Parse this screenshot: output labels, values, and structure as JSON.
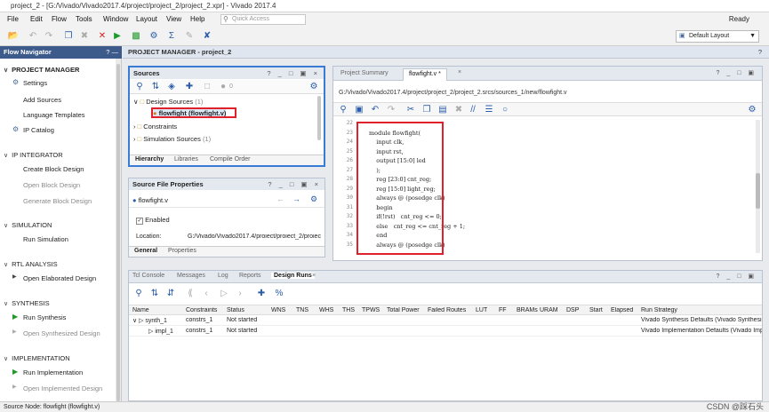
{
  "window": {
    "title": "project_2 - [G:/Vivado/Vivado2017.4/project/project_2/project_2.xpr] - Vivado 2017.4",
    "status": "Ready"
  },
  "menu": [
    "File",
    "Edit",
    "Flow",
    "Tools",
    "Window",
    "Layout",
    "View",
    "Help"
  ],
  "quick_access": {
    "placeholder": "Quick Access"
  },
  "layout_select": {
    "value": "Default Layout"
  },
  "flow_navigator": {
    "title": "Flow Navigator",
    "controls": "? —",
    "sections": [
      {
        "label": "PROJECT MANAGER",
        "items": [
          "Settings",
          "Add Sources",
          "Language Templates",
          "IP Catalog"
        ]
      },
      {
        "label": "IP INTEGRATOR",
        "items": [
          "Create Block Design",
          "Open Block Design",
          "Generate Block Design"
        ]
      },
      {
        "label": "SIMULATION",
        "items": [
          "Run Simulation"
        ]
      },
      {
        "label": "RTL ANALYSIS",
        "items": [
          "Open Elaborated Design"
        ]
      },
      {
        "label": "SYNTHESIS",
        "items": [
          "Run Synthesis",
          "Open Synthesized Design"
        ]
      },
      {
        "label": "IMPLEMENTATION",
        "items": [
          "Run Implementation",
          "Open Implemented Design"
        ]
      }
    ]
  },
  "project_manager": {
    "title": "PROJECT MANAGER - project_2",
    "help": "?"
  },
  "sources": {
    "title": "Sources",
    "controls": "? _ □ ▣ ×",
    "badge": "0",
    "tree": [
      {
        "label": "Design Sources",
        "count": "(1)"
      },
      {
        "label": "flowfight (flowfight.v)"
      },
      {
        "label": "Constraints"
      },
      {
        "label": "Simulation Sources",
        "count": "(1)"
      }
    ],
    "tabs": [
      "Hierarchy",
      "Libraries",
      "Compile Order"
    ]
  },
  "source_file_properties": {
    "title": "Source File Properties",
    "controls": "? _ □ ▣ ×",
    "file": "flowfight.v",
    "enabled_label": "Enabled",
    "location_label": "Location:",
    "location_value": "G:/Vivado/Vivado2017.4/proiect/proiect_2/proiect",
    "tabs": [
      "General",
      "Properties"
    ]
  },
  "editor": {
    "tabs": [
      "Project Summary",
      "flowfight.v *"
    ],
    "controls": "? _ □ ▣",
    "path": "G:/Vivado/Vivado2017.4/project/project_2/project_2.srcs/sources_1/new/flowfight.v",
    "lines": [
      {
        "n": "22",
        "code": ""
      },
      {
        "n": "23",
        "code": "module flowfight("
      },
      {
        "n": "24",
        "code": "    input clk,"
      },
      {
        "n": "25",
        "code": "    input rst,"
      },
      {
        "n": "26",
        "code": "    output [15:0] led"
      },
      {
        "n": "27",
        "code": "    );"
      },
      {
        "n": "28",
        "code": "    reg [23:0] cnt_reg;"
      },
      {
        "n": "29",
        "code": "    reg [15:0] light_reg;"
      },
      {
        "n": "30",
        "code": "    always @ (posedge clk)"
      },
      {
        "n": "31",
        "code": "    begin"
      },
      {
        "n": "32",
        "code": "    if(!rst)   cnt_reg <= 0;"
      },
      {
        "n": "33",
        "code": "    else   cnt_reg <= cnt_reg + 1;"
      },
      {
        "n": "34",
        "code": "    end"
      },
      {
        "n": "35",
        "code": "    always @ (posedge clk)"
      }
    ]
  },
  "bottom_panel": {
    "tabs": [
      "Tcl Console",
      "Messages",
      "Log",
      "Reports",
      "Design Runs"
    ],
    "controls": "? _ □ ▣",
    "columns": [
      "Name",
      "Constraints",
      "Status",
      "WNS",
      "TNS",
      "WHS",
      "THS",
      "TPWS",
      "Total Power",
      "Failed Routes",
      "LUT",
      "FF",
      "BRAMs",
      "URAM",
      "DSP",
      "Start",
      "Elapsed",
      "Run Strategy"
    ],
    "rows": [
      {
        "name": "synth_1",
        "constraints": "constrs_1",
        "status": "Not started",
        "strategy": "Vivado Synthesis Defaults (Vivado Synthesis"
      },
      {
        "name": "impl_1",
        "constraints": "constrs_1",
        "status": "Not started",
        "strategy": "Vivado Implementation Defaults (Vivado Imp"
      }
    ]
  },
  "statusbar": {
    "text": "Source Node: flowfight (flowfight.v)",
    "watermark": "CSDN @踩石头"
  },
  "colors": {
    "accent": "#3c5a8a",
    "highlight_box": "#e0202a",
    "selection": "#3a7bd5"
  }
}
